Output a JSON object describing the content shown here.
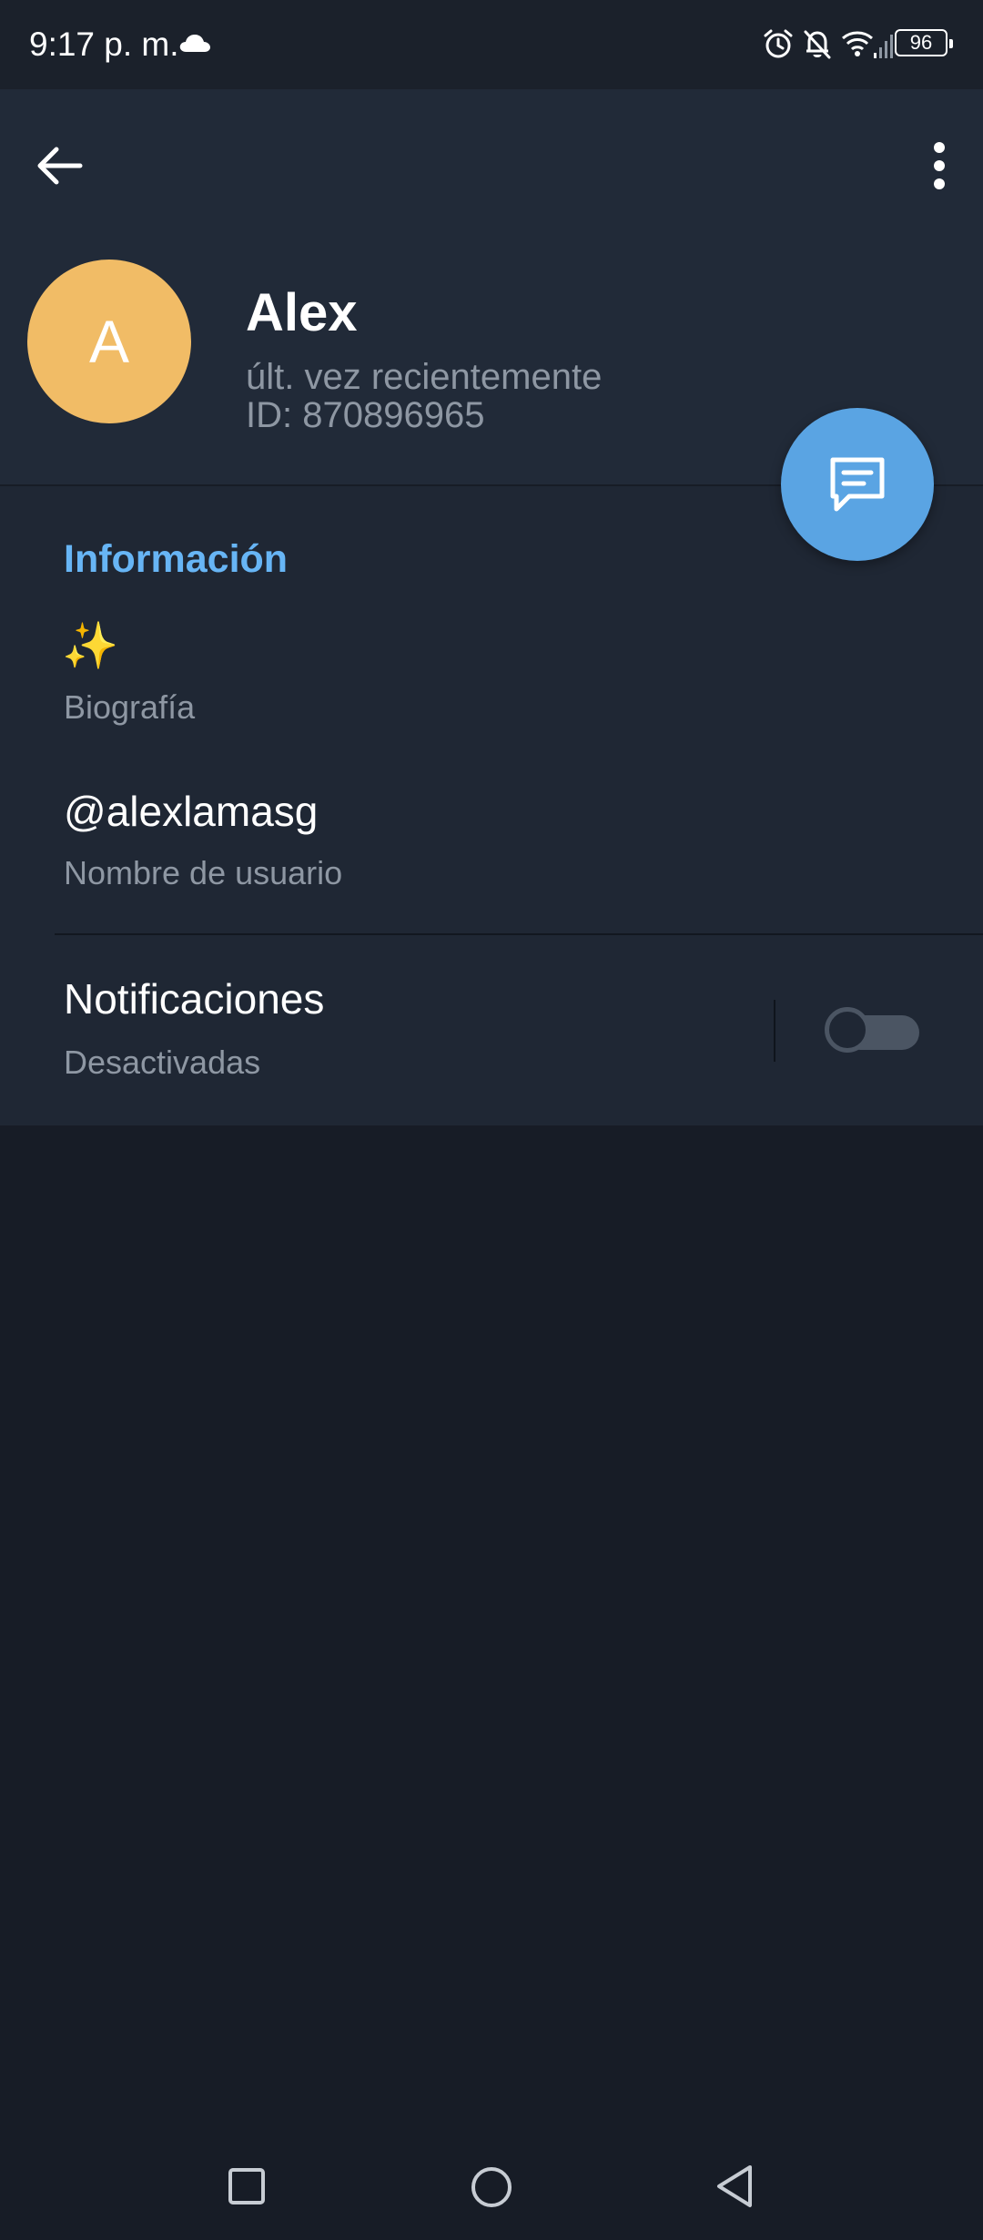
{
  "status_bar": {
    "time": "9:17 p. m.",
    "battery": "96",
    "icons": [
      "cloud-icon",
      "alarm-icon",
      "bell-off-icon",
      "wifi-icon",
      "signal-icon",
      "battery-icon"
    ]
  },
  "header": {
    "back_icon": "arrow-left-icon",
    "more_icon": "more-vertical-icon"
  },
  "profile": {
    "avatar_letter": "A",
    "avatar_color": "#f1bc66",
    "name": "Alex",
    "last_seen": "últ. vez recientemente",
    "user_id": "ID: 870896965"
  },
  "fab": {
    "icon": "message-icon",
    "color": "#5aa4e3"
  },
  "info": {
    "title": "Información",
    "bio_value": "✨",
    "bio_label": "Biografía",
    "username_value": "@alexlamasg",
    "username_label": "Nombre de usuario",
    "notifications_title": "Notificaciones",
    "notifications_status": "Desactivadas",
    "notifications_enabled": false
  },
  "nav_bar": {
    "icons": [
      "recent-apps-icon",
      "home-icon",
      "back-icon"
    ]
  },
  "colors": {
    "accent": "#67b5f5",
    "background": "#171c26",
    "header": "#212a38",
    "secondary_text": "#8e97a3"
  }
}
